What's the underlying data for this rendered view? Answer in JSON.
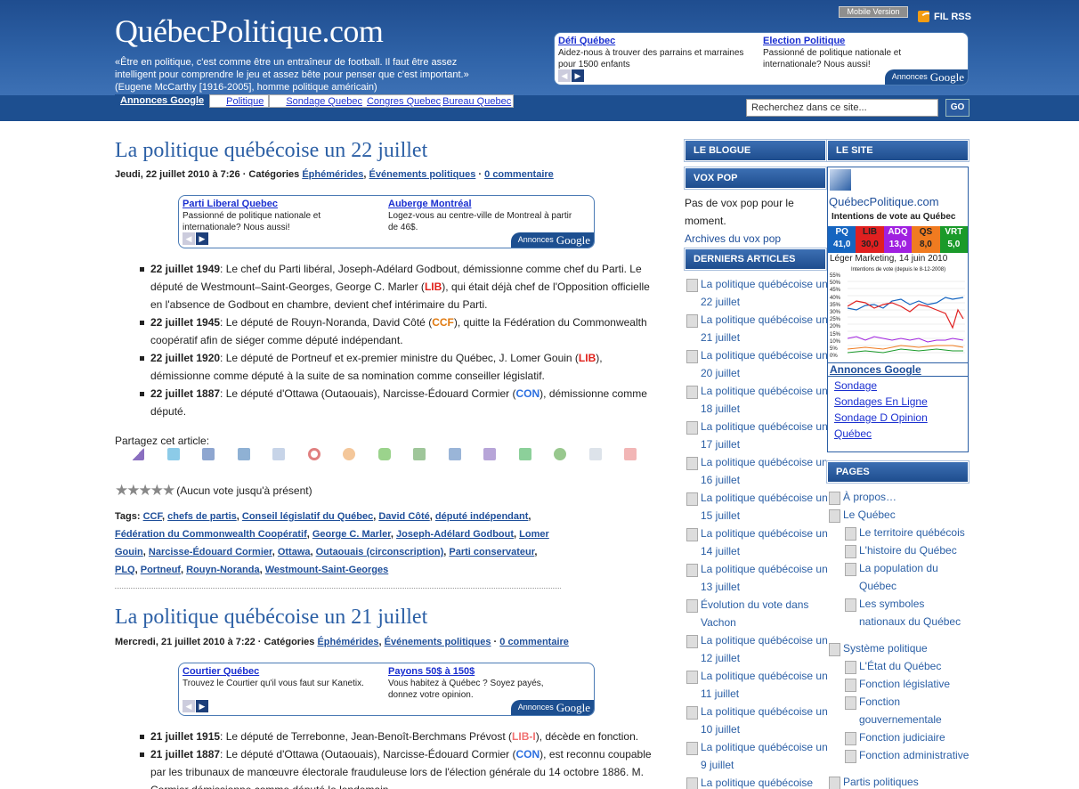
{
  "header": {
    "logo": "QuébecPolitique.com",
    "quote_lines": [
      "«Être en politique, c'est comme être un entraîneur de football. Il faut être assez",
      "intelligent pour comprendre le jeu et assez bête pour penser que c'est important.»",
      "(Eugene McCarthy [1916-2005], homme politique américain)"
    ],
    "mobile": "Mobile Version",
    "rss": "FIL RSS",
    "ad": {
      "items": [
        {
          "title": "Défi Québec",
          "desc": "Aidez-nous à trouver des parrains et marraines pour 1500 enfants"
        },
        {
          "title": "Election Politique",
          "desc": "Passionné de politique nationale et internationale? Nous aussi!"
        }
      ],
      "label": "Annonces",
      "brand": "Google"
    },
    "links": [
      "Annonces Google",
      "Politique",
      "Sondage Quebec",
      "Congres Quebec",
      "Bureau Quebec"
    ],
    "search_placeholder": "Recherchez dans ce site...",
    "go": "GO"
  },
  "posts": [
    {
      "title": "La politique québécoise un 22 juillet",
      "meta_date": "Jeudi, 22 juillet 2010 à 7:26 · Catégories",
      "cat1": "Éphémérides",
      "cat2": "Événements politiques",
      "comments": "0 commentaire",
      "ad": [
        {
          "title": "Parti Liberal Quebec",
          "desc": "Passionné de politique nationale et internationale? Nous aussi!"
        },
        {
          "title": "Auberge Montréal",
          "desc": "Logez-vous au centre-ville de Montreal à partir de 46$."
        }
      ]
    },
    {
      "title": "La politique québécoise un 21 juillet",
      "meta_date": "Mercredi, 21 juillet 2010 à 7:22 · Catégories",
      "cat1": "Éphémérides",
      "cat2": "Événements politiques",
      "comments": "0 commentaire",
      "ad": [
        {
          "title": "Courtier Québec",
          "desc": "Trouvez le Courtier qu'il vous faut sur Kanetix."
        },
        {
          "title": "Payons 50$ à 150$",
          "desc": "Vous habitez à Québec ? Soyez payés, donnez votre opinion."
        }
      ]
    }
  ],
  "post1_items": {
    "a_date": "22 juillet 1949",
    "a_text1": ": Le chef du Parti libéral, Joseph-Adélard Godbout, démissionne comme chef du Parti. Le député de Westmount–Saint-Georges, George C. Marler (",
    "a_party": "LIB",
    "a_text2": "), qui était déjà chef de l'Opposition officielle en l'absence de Godbout en chambre, devient chef intérimaire du Parti.",
    "b_date": "22 juillet 1945",
    "b_text1": ": Le député de Rouyn-Noranda, David Côté (",
    "b_party": "CCF",
    "b_text2": "), quitte la Fédération du Commonwealth coopératif afin de siéger comme député indépendant.",
    "c_date": "22 juillet 1920",
    "c_text1": ": Le député de Portneuf et ex-premier ministre du Québec, J. Lomer Gouin (",
    "c_party": "LIB",
    "c_text2": "), démissionne comme député à la suite de sa nomination comme conseiller législatif.",
    "d_date": "22 juillet 1887",
    "d_text1": ": Le député d'Ottawa (Outaouais), Narcisse-Édouard Cormier (",
    "d_party": "CON",
    "d_text2": "), démissionne comme député."
  },
  "share": "Partagez cet article:",
  "vote": "(Aucun vote jusqu'à présent)",
  "tags_label": "Tags:",
  "tags": [
    "CCF",
    "chefs de partis",
    "Conseil législatif du Québec",
    "David Côté",
    "député indépendant",
    "Fédération du Commonwealth Coopératif",
    "George C. Marler",
    "Joseph-Adélard Godbout",
    "Lomer Gouin",
    "Narcisse-Édouard Cormier",
    "Ottawa",
    "Outaouais (circonscription)",
    "Parti conservateur",
    "PLQ",
    "Portneuf",
    "Rouyn-Noranda",
    "Westmount-Saint-Georges"
  ],
  "post2_items": {
    "a_date": "21 juillet 1915",
    "a_text1": ": Le député de Terrebonne, Jean-Benoît-Berchmans Prévost (",
    "a_party": "LIB-I",
    "a_text2": "), décède en fonction.",
    "b_date": "21 juillet 1887",
    "b_text1": ": Le député d'Ottawa (Outaouais), Narcisse-Édouard Cormier (",
    "b_party": "CON",
    "b_text2": "), est reconnu coupable par les tribunaux de manœuvre électorale frauduleuse lors de l'élection générale du 14 octobre 1886. M. Cormier démissionne comme député le lendemain."
  },
  "sidebar": {
    "blogue": "LE BLOGUE",
    "site": "LE SITE",
    "voxpop": "VOX POP",
    "voxpop_text": "Pas de vox pop pour le moment.",
    "voxpop_link": "Archives du vox pop",
    "derniers": "DERNIERS ARTICLES",
    "articles": [
      "La politique québécoise un 22 juillet",
      "La politique québécoise un 21 juillet",
      "La politique québécoise un 20 juillet",
      "La politique québécoise un 18 juillet",
      "La politique québécoise un 17 juillet",
      "La politique québécoise un 16 juillet",
      "La politique québécoise un 15 juillet",
      "La politique québécoise un 14 juillet",
      "La politique québécoise un 13 juillet",
      "Évolution du vote dans Vachon",
      "La politique québécoise un 12 juillet",
      "La politique québécoise un 11 juillet",
      "La politique québécoise un 10 juillet",
      "La politique québécoise un 9 juillet",
      "La politique québécoise"
    ],
    "sondage": {
      "brand": "QuébecPolitique.com",
      "title": "Intentions de vote au Québec",
      "parties": [
        {
          "name": "PQ",
          "value": "41,0",
          "color": "#1565c0"
        },
        {
          "name": "LIB",
          "value": "30,0",
          "color": "#e02020"
        },
        {
          "name": "ADQ",
          "value": "13,0",
          "color": "#a020e0"
        },
        {
          "name": "QS",
          "value": "8,0",
          "color": "#f07b20"
        },
        {
          "name": "VRT",
          "value": "5,0",
          "color": "#1a9a2a"
        }
      ],
      "source": "Léger Marketing, 14 juin 2010",
      "chart_title": "Intentions de vote (depuis le 8-12-2008)",
      "yticks": [
        "55%",
        "50%",
        "45%",
        "40%",
        "35%",
        "30%",
        "25%",
        "20%",
        "15%",
        "10%",
        "5%",
        "0%"
      ]
    },
    "ads_title": "Annonces Google",
    "ads": [
      "Sondage",
      "Sondages En Ligne",
      "Sondage D Opinion",
      "Québec"
    ],
    "pages_title": "PAGES",
    "pages": [
      {
        "label": "À propos…",
        "sub": false
      },
      {
        "label": "Le Québec",
        "sub": false
      },
      {
        "label": "Le territoire québécois",
        "sub": true
      },
      {
        "label": "L'histoire du Québec",
        "sub": true
      },
      {
        "label": "La population du Québec",
        "sub": true
      },
      {
        "label": "Les symboles nationaux du Québec",
        "sub": true
      },
      {
        "label": "Système politique",
        "sub": false
      },
      {
        "label": "L'État du Québec",
        "sub": true
      },
      {
        "label": "Fonction législative",
        "sub": true
      },
      {
        "label": "Fonction gouvernementale",
        "sub": true
      },
      {
        "label": "Fonction judiciaire",
        "sub": true
      },
      {
        "label": "Fonction administrative",
        "sub": true
      },
      {
        "label": "Partis politiques",
        "sub": false
      }
    ]
  }
}
